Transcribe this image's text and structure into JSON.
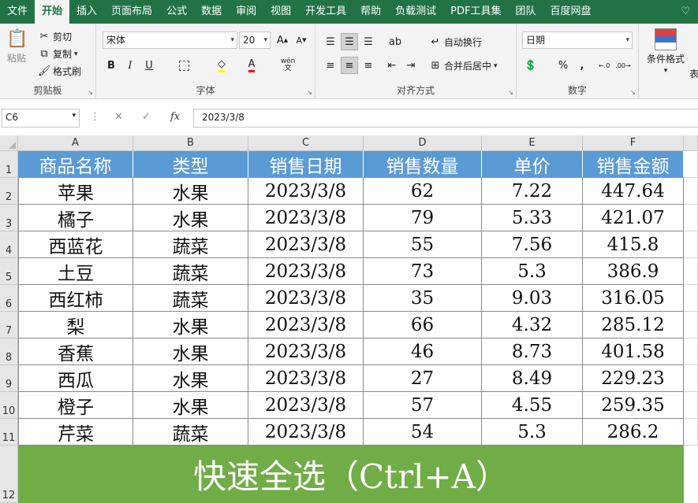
{
  "tabs": [
    "文件",
    "开始",
    "插入",
    "页面布局",
    "公式",
    "数据",
    "审阅",
    "视图",
    "开发工具",
    "帮助",
    "负载测试",
    "PDF工具集",
    "团队",
    "百度网盘"
  ],
  "tab_active": "开始",
  "tab_bulb": "♡",
  "ribbon": {
    "clipboard": {
      "paste": "粘贴",
      "cut": "剪切",
      "copy": "复制",
      "painter": "格式刷",
      "label": "剪贴板"
    },
    "font": {
      "name": "宋体",
      "size": "20",
      "grow": "A",
      "shrink": "A",
      "bold": "B",
      "italic": "I",
      "underline": "U",
      "fill_color": "A",
      "font_color": "A",
      "wen": "wén",
      "label": "字体"
    },
    "align": {
      "wrap": "自动换行",
      "merge": "合并后居中",
      "label": "对齐方式"
    },
    "number": {
      "format": "日期",
      "percent": "%",
      "comma": ",",
      "label": "数字"
    },
    "styles": {
      "cond": "条件格式",
      "table": "表"
    }
  },
  "formula_bar": {
    "namebox": "C6",
    "cancel": "✕",
    "enter": "✓",
    "fx": "fx",
    "value": "2023/3/8"
  },
  "sheet": {
    "columns": [
      "A",
      "B",
      "C",
      "D",
      "E",
      "F"
    ],
    "rows": [
      "1",
      "2",
      "3",
      "4",
      "5",
      "6",
      "7",
      "8",
      "9",
      "10",
      "11",
      "12"
    ],
    "headers": [
      "商品名称",
      "类型",
      "销售日期",
      "销售数量",
      "单价",
      "销售金额"
    ],
    "data": [
      [
        "苹果",
        "水果",
        "2023/3/8",
        "62",
        "7.22",
        "447.64"
      ],
      [
        "橘子",
        "水果",
        "2023/3/8",
        "79",
        "5.33",
        "421.07"
      ],
      [
        "西蓝花",
        "蔬菜",
        "2023/3/8",
        "55",
        "7.56",
        "415.8"
      ],
      [
        "土豆",
        "蔬菜",
        "2023/3/8",
        "73",
        "5.3",
        "386.9"
      ],
      [
        "西红柿",
        "蔬菜",
        "2023/3/8",
        "35",
        "9.03",
        "316.05"
      ],
      [
        "梨",
        "水果",
        "2023/3/8",
        "66",
        "4.32",
        "285.12"
      ],
      [
        "香蕉",
        "水果",
        "2023/3/8",
        "46",
        "8.73",
        "401.58"
      ],
      [
        "西瓜",
        "水果",
        "2023/3/8",
        "27",
        "8.49",
        "229.23"
      ],
      [
        "橙子",
        "水果",
        "2023/3/8",
        "57",
        "4.55",
        "259.35"
      ],
      [
        "芹菜",
        "蔬菜",
        "2023/3/8",
        "54",
        "5.3",
        "286.2"
      ]
    ]
  },
  "banner": "快速全选（Ctrl+A）",
  "colors": {
    "ribbon_green": "#217346",
    "header_blue": "#5b9bd5",
    "banner_green": "#70ad47"
  }
}
